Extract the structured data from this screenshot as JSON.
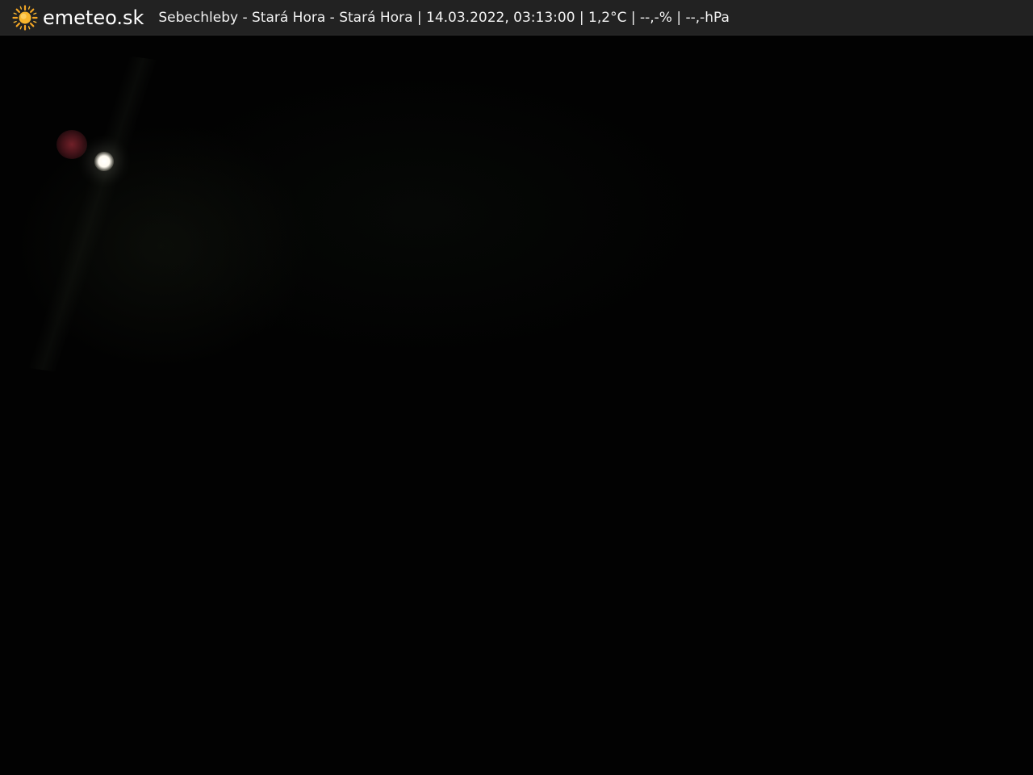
{
  "header": {
    "brand": "emeteo.sk",
    "logo_icon": "sun-icon",
    "caption": "Sebechleby - Stará Hora - Stará Hora | 14.03.2022, 03:13:00 | 1,2°C | --,-% | --,-hPa"
  },
  "colors": {
    "header_bg": "#222222",
    "sun": "#f5a623",
    "text": "#ffffff",
    "scene": "#020202"
  }
}
